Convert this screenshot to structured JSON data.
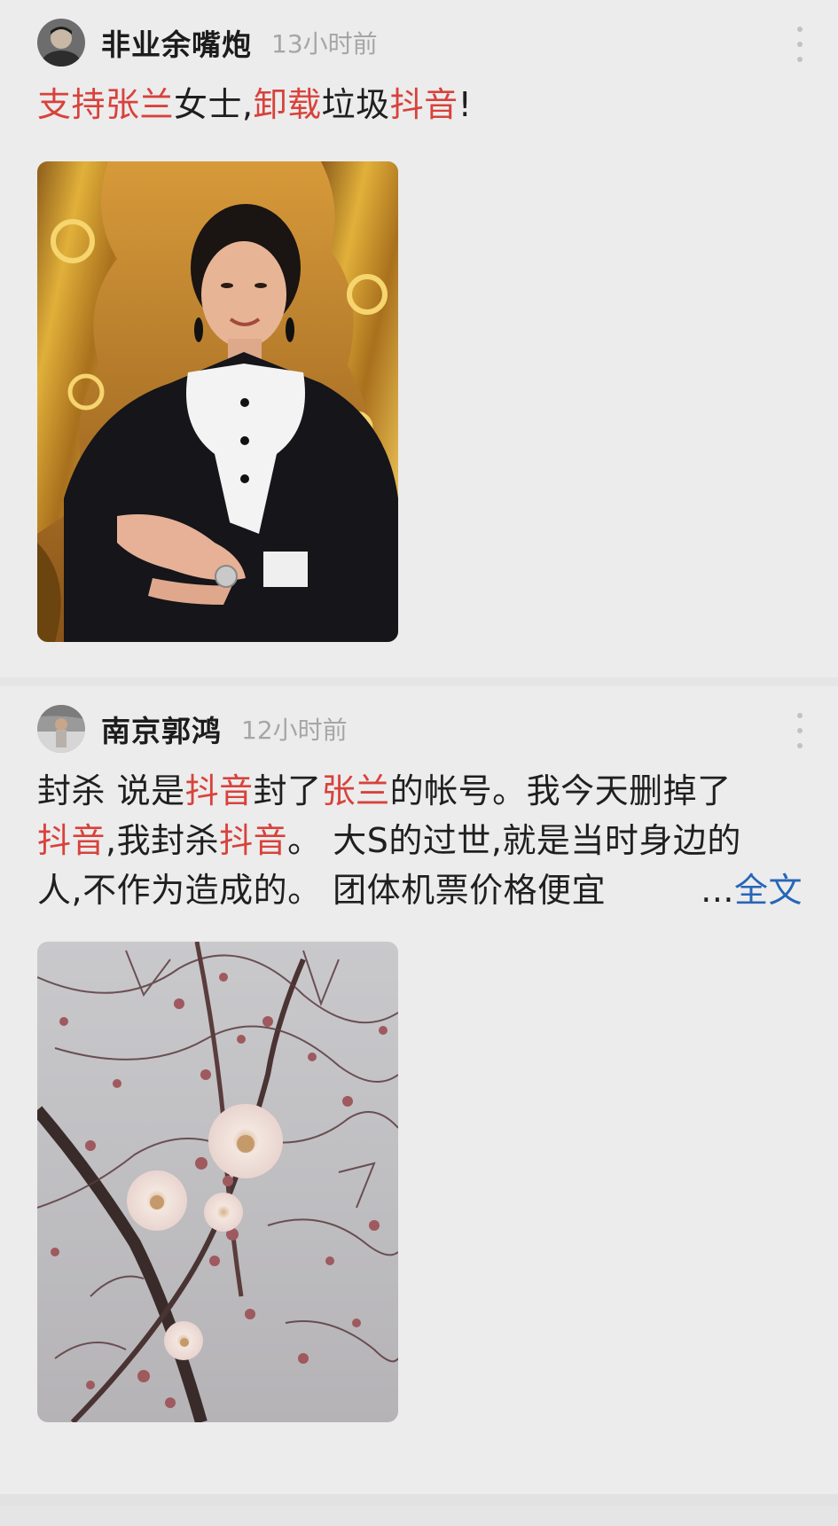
{
  "posts": [
    {
      "username": "非业余嘴炮",
      "timestamp": "13小时前",
      "text_segments": [
        {
          "text": "支持张兰",
          "highlight": true
        },
        {
          "text": "女士,",
          "highlight": false
        },
        {
          "text": "卸载",
          "highlight": true
        },
        {
          "text": "垃圾",
          "highlight": false
        },
        {
          "text": "抖音",
          "highlight": true
        },
        {
          "text": "!",
          "highlight": false
        }
      ],
      "image_icon": "portrait-photo"
    },
    {
      "username": "南京郭鸿",
      "timestamp": "12小时前",
      "line1": [
        {
          "text": "封杀 说是",
          "highlight": false
        },
        {
          "text": "抖音",
          "highlight": true
        },
        {
          "text": "封了",
          "highlight": false
        },
        {
          "text": "张兰",
          "highlight": true
        },
        {
          "text": "的帐号。我今天删掉了",
          "highlight": false
        }
      ],
      "line2": [
        {
          "text": "抖音",
          "highlight": true
        },
        {
          "text": ",我封杀",
          "highlight": false
        },
        {
          "text": "抖音",
          "highlight": true
        },
        {
          "text": "。 大S的过世,就是当时身边的",
          "highlight": false
        }
      ],
      "line3": "人,不作为造成的。 团体机票价格便宜",
      "ellipsis": "...",
      "expand_label": "全文",
      "image_icon": "plum-blossom-photo"
    }
  ],
  "colors": {
    "highlight": "#d8423c",
    "link": "#2765b8",
    "background": "#ececec"
  }
}
